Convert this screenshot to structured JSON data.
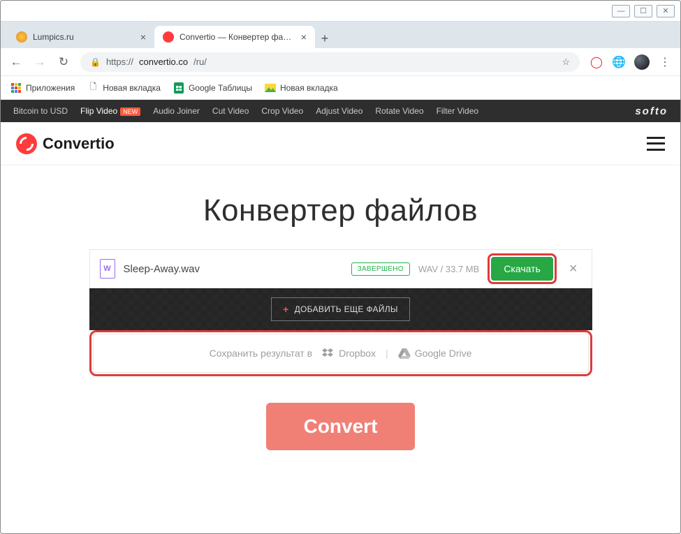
{
  "browser": {
    "tabs": [
      {
        "title": "Lumpics.ru",
        "favicon_color": "#f0a020"
      },
      {
        "title": "Convertio — Конвертер файлов",
        "favicon_color": "#ff3b3b"
      }
    ],
    "url_scheme": "https://",
    "url_host": "convertio.co",
    "url_path": "/ru/",
    "bookmarks": [
      {
        "label": "Приложения",
        "icon": "apps"
      },
      {
        "label": "Новая вкладка",
        "icon": "file"
      },
      {
        "label": "Google Таблицы",
        "icon": "sheets"
      },
      {
        "label": "Новая вкладка",
        "icon": "img"
      }
    ]
  },
  "softo": {
    "items": [
      {
        "label": "Bitcoin to USD",
        "badge": ""
      },
      {
        "label": "Flip Video",
        "badge": "NEW"
      },
      {
        "label": "Audio Joiner",
        "badge": ""
      },
      {
        "label": "Cut Video",
        "badge": ""
      },
      {
        "label": "Crop Video",
        "badge": ""
      },
      {
        "label": "Adjust Video",
        "badge": ""
      },
      {
        "label": "Rotate Video",
        "badge": ""
      },
      {
        "label": "Filter Video",
        "badge": ""
      }
    ],
    "brand": "softo"
  },
  "header": {
    "brand": "Convertio"
  },
  "hero": {
    "title": "Конвертер файлов"
  },
  "file": {
    "icon_letter": "W",
    "name": "Sleep-Away.wav",
    "status": "ЗАВЕРШЕНО",
    "info": "WAV / 33.7 MB",
    "download": "Скачать"
  },
  "addmore": "ДОБАВИТЬ ЕЩЕ ФАЙЛЫ",
  "save": {
    "label": "Сохранить результат в",
    "dropbox": "Dropbox",
    "gdrive": "Google Drive"
  },
  "convert": "Convert"
}
